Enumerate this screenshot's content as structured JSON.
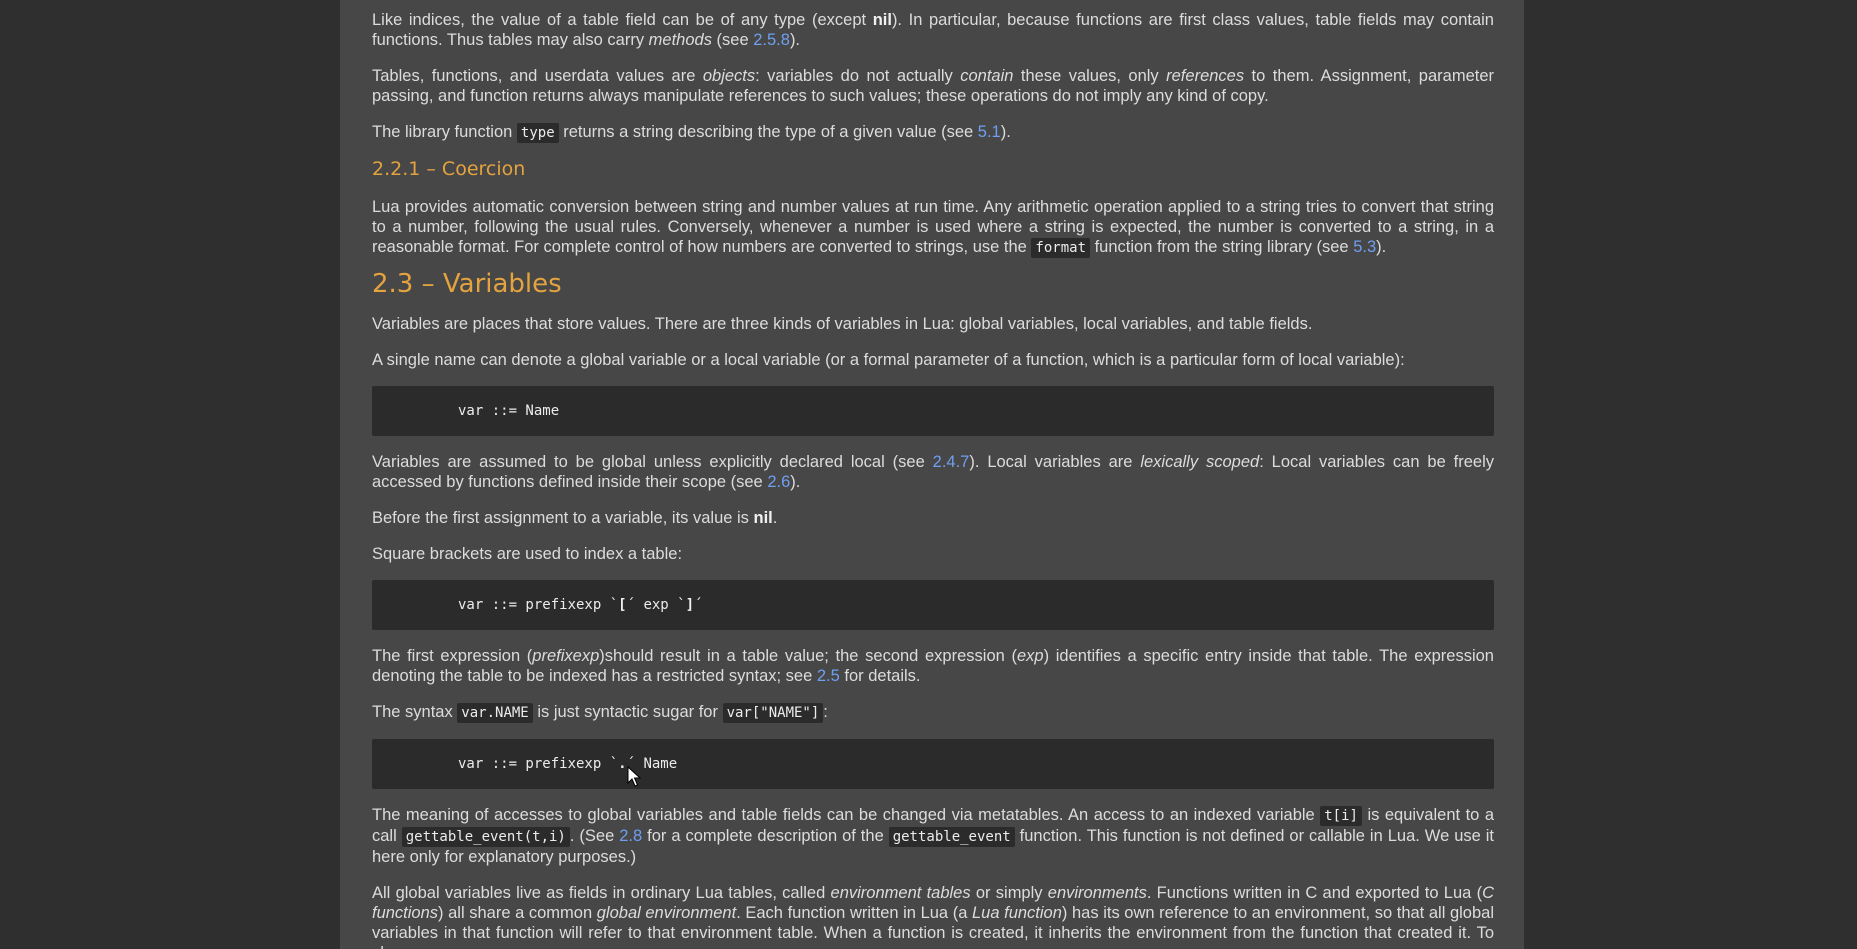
{
  "p1": {
    "t1": "Like indices, the value of a table field can be of any type (except ",
    "nil": "nil",
    "t2": "). In particular, because functions are first class values, table fields may contain functions. Thus tables may also carry ",
    "methods": "methods",
    "t3": " (see ",
    "link": "2.5.8",
    "t4": ")."
  },
  "p2": {
    "t1": "Tables, functions, and userdata values are ",
    "objects": "objects",
    "t2": ": variables do not actually ",
    "contain": "contain",
    "t3": " these values, only ",
    "references": "references",
    "t4": " to them. Assignment, parameter passing, and function returns always manipulate references to such values; these operations do not imply any kind of copy."
  },
  "p3": {
    "t1": "The library function ",
    "code": "type",
    "t2": " returns a string describing the type of a given value (see ",
    "link": "5.1",
    "t3": ")."
  },
  "h_coercion": "2.2.1 – Coercion",
  "p4": {
    "t1": "Lua provides automatic conversion between string and number values at run time. Any arithmetic operation applied to a string tries to convert that string to a number, following the usual rules. Conversely, whenever a number is used where a string is expected, the number is converted to a string, in a reasonable format. For complete control of how numbers are converted to strings, use the ",
    "code": "format",
    "t2": " function from the string library (see ",
    "link": "5.3",
    "t3": ")."
  },
  "h_variables": "2.3 – Variables",
  "p5": "Variables are places that store values. There are three kinds of variables in Lua: global variables, local variables, and table fields.",
  "p6": "A single name can denote a global variable or a local variable (or a formal parameter of a function, which is a particular form of local variable):",
  "code1": "var ::= Name",
  "p7": {
    "t1": "Variables are assumed to be global unless explicitly declared local (see ",
    "link1": "2.4.7",
    "t2": "). Local variables are ",
    "lex": "lexically scoped",
    "t3": ": Local variables can be freely accessed by functions defined inside their scope (see ",
    "link2": "2.6",
    "t4": ")."
  },
  "p8": {
    "t1": "Before the first assignment to a variable, its value is ",
    "nil": "nil",
    "t2": "."
  },
  "p9": "Square brackets are used to index a table:",
  "code2": {
    "t1": "var ::= prefixexp `",
    "b1": "[",
    "t2": "´ exp `",
    "b2": "]",
    "t3": "´"
  },
  "p10": {
    "t1": "The first expression (",
    "prefixexp": "prefixexp",
    "t2": ")should result in a table value; the second expression (",
    "exp": "exp",
    "t3": ") identifies a specific entry inside that table. The expression denoting the table to be indexed has a restricted syntax; see ",
    "link": "2.5",
    "t4": " for details."
  },
  "p11": {
    "t1": "The syntax ",
    "code1": "var.NAME",
    "t2": " is just syntactic sugar for ",
    "code2": "var[\"NAME\"]",
    "t3": ":"
  },
  "code3": {
    "t1": "var ::= prefixexp `",
    "b1": ".",
    "t2": "´ Name"
  },
  "p12": {
    "t1": "The meaning of accesses to global variables and table fields can be changed via metatables. An access to an indexed variable ",
    "code1": "t[i]",
    "t2": " is equivalent to a call ",
    "code2": "gettable_event(t,i)",
    "t3": ". (See ",
    "link": "2.8",
    "t4": " for a complete description of the ",
    "code3": "gettable_event",
    "t5": " function. This function is not defined or callable in Lua. We use it here only for explanatory purposes.)"
  },
  "p13": {
    "t1": "All global variables live as fields in ordinary Lua tables, called ",
    "env_tables": "environment tables",
    "t2": " or simply ",
    "envs": "environments",
    "t3": ". Functions written in C and exported to Lua (",
    "cfunc": "C functions",
    "t4": ") all share a common ",
    "genv": "global environment",
    "t5": ". Each function written in Lua (a ",
    "luafunc": "Lua function",
    "t6": ") has its own reference to an environment, so that all global variables in that function will refer to that environment table. When a function is created, it inherits the environment from the function that created it. To change"
  },
  "colors": {
    "page_bg": "#474747",
    "outer_bg": "#2f2f2f",
    "heading": "#e3a33f",
    "link": "#6f9ff0",
    "code_bg": "#2b2b2b"
  },
  "cursor_icon": "mouse-pointer-icon"
}
